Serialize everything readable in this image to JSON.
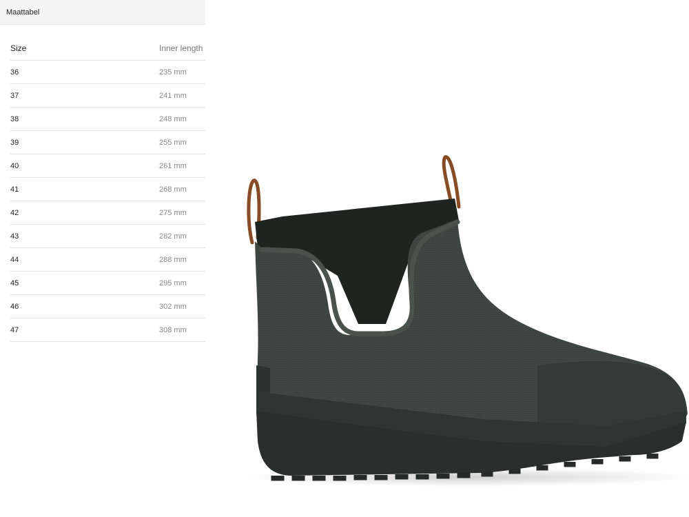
{
  "panel": {
    "title": "Maattabel"
  },
  "table": {
    "headers": {
      "size": "Size",
      "length": "Inner length"
    },
    "rows": [
      {
        "size": "36",
        "length": "235 mm"
      },
      {
        "size": "37",
        "length": "241 mm"
      },
      {
        "size": "38",
        "length": "248 mm"
      },
      {
        "size": "39",
        "length": "255 mm"
      },
      {
        "size": "40",
        "length": "261 mm"
      },
      {
        "size": "41",
        "length": "268 mm"
      },
      {
        "size": "42",
        "length": "275 mm"
      },
      {
        "size": "43",
        "length": "282 mm"
      },
      {
        "size": "44",
        "length": "288 mm"
      },
      {
        "size": "45",
        "length": "295 mm"
      },
      {
        "size": "46",
        "length": "302 mm"
      },
      {
        "size": "47",
        "length": "308 mm"
      }
    ]
  },
  "product_image": {
    "icon": "boot-image",
    "colors": {
      "rubber": "#3a403d",
      "neoprene": "#1f2421",
      "tab": "#8a4a22"
    }
  }
}
